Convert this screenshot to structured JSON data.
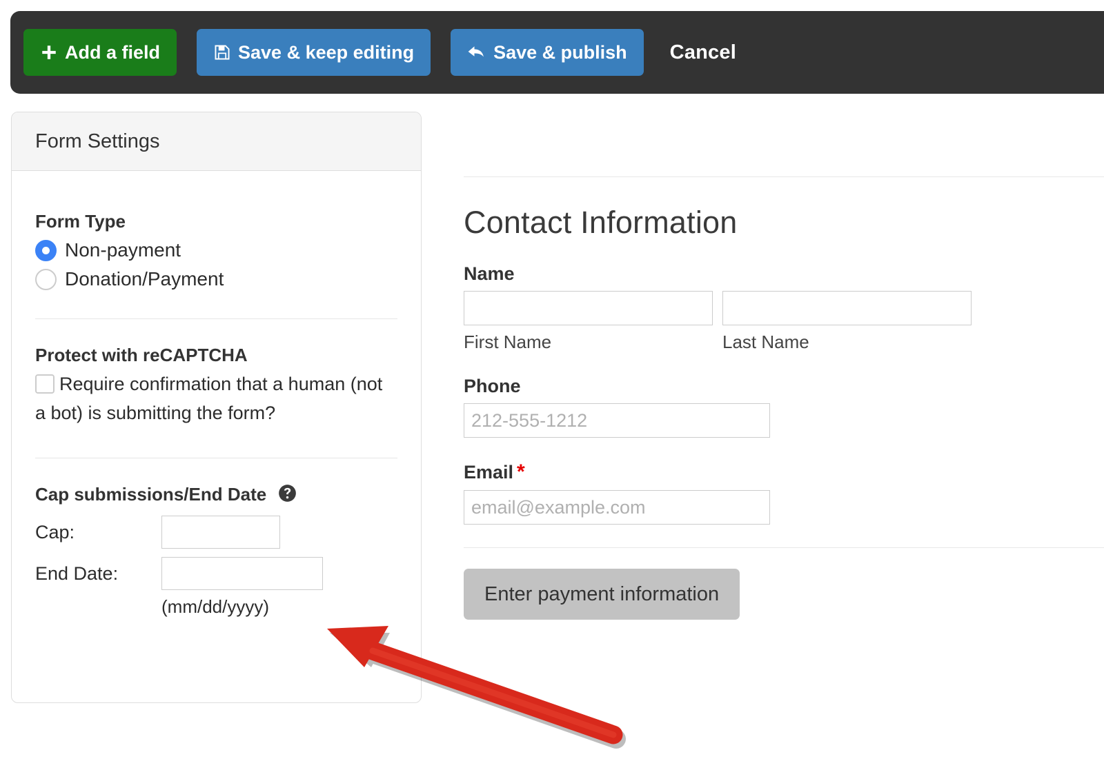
{
  "toolbar": {
    "add_field_label": "Add a field",
    "add_field_icon": "plus-icon",
    "save_keep_editing_label": "Save & keep editing",
    "save_keep_editing_icon": "floppy-disk-save-icon",
    "save_publish_label": "Save & publish",
    "save_publish_icon": "curved-reply-arrow-icon",
    "cancel_label": "Cancel",
    "background_color": "#333333",
    "green_color": "#1a7d1a",
    "blue_color": "#3a7fbd"
  },
  "sidebar": {
    "header_title": "Form Settings",
    "form_type": {
      "section_title": "Form Type",
      "options": [
        {
          "label": "Non-payment",
          "selected": true
        },
        {
          "label": "Donation/Payment",
          "selected": false
        }
      ],
      "selected_color": "#3b82f6"
    },
    "recaptcha": {
      "section_title": "Protect with reCAPTCHA",
      "checkbox_label": "Require confirmation that a human (not a bot) is submitting the form?",
      "checked": false
    },
    "cap_submissions": {
      "section_title": "Cap submissions/End Date",
      "help_icon": "question-mark-circle-icon",
      "cap_label": "Cap:",
      "cap_value": "",
      "end_date_label": "End Date:",
      "end_date_value": "",
      "date_format_hint": "(mm/dd/yyyy)"
    }
  },
  "form_preview": {
    "title": "Contact Information",
    "name": {
      "label": "Name",
      "first_value": "",
      "first_sublabel": "First Name",
      "last_value": "",
      "last_sublabel": "Last Name"
    },
    "phone": {
      "label": "Phone",
      "value": "",
      "placeholder": "212-555-1212"
    },
    "email": {
      "label": "Email",
      "required_marker": "*",
      "required_color": "#e60000",
      "value": "",
      "placeholder": "email@example.com"
    },
    "payment_button_label": "Enter payment information"
  },
  "annotation": {
    "arrow_color": "#d8291c",
    "arrow_points_to": "End Date:"
  }
}
